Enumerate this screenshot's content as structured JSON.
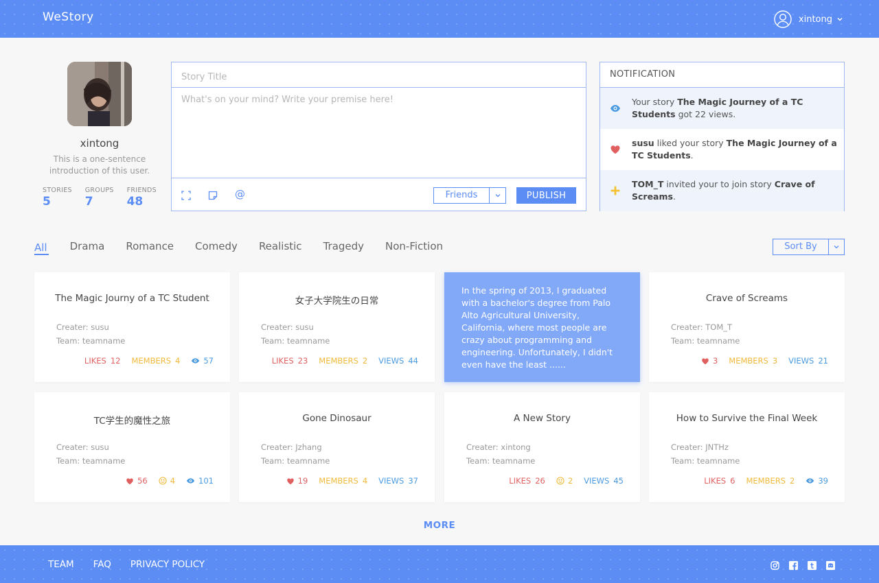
{
  "header": {
    "brand": "WeStory",
    "username": "xintong"
  },
  "profile": {
    "name": "xintong",
    "intro": "This is a one-sentence introduction of this user.",
    "stats": [
      {
        "label": "STORIES",
        "value": "5"
      },
      {
        "label": "GROUPS",
        "value": "7"
      },
      {
        "label": "FRIENDS",
        "value": "48"
      }
    ]
  },
  "composer": {
    "title_placeholder": "Story Title",
    "body_placeholder": "What's on your mind? Write your premise here!",
    "visibility": "Friends",
    "publish_label": "PUBLISH",
    "at_symbol": "@"
  },
  "notifications": {
    "heading": "NOTIFICATION",
    "items": [
      {
        "icon": "eye-icon",
        "p1": "Your story ",
        "b1": "The Magic Journey of a TC Students",
        "p2": " got 22 views.",
        "b2": "",
        "p3": ""
      },
      {
        "icon": "heart-icon",
        "p1": "",
        "b1": "susu",
        "p2": " liked your story ",
        "b2": "The Magic Journey of a TC Students",
        "p3": "."
      },
      {
        "icon": "plus-icon",
        "p1": "",
        "b1": "TOM_T",
        "p2": " invited your to join story ",
        "b2": "Crave of Screams",
        "p3": "."
      }
    ]
  },
  "tabs": [
    "All",
    "Drama",
    "Romance",
    "Comedy",
    "Realistic",
    "Tragedy",
    "Non-Fiction"
  ],
  "sort_label": "Sort By",
  "cards": [
    {
      "title": "The Magic Journy of a TC Student",
      "creator": "Creater: susu",
      "team": "Team: teamname",
      "likes": {
        "icon": false,
        "label": "LIKES",
        "value": "12"
      },
      "members": {
        "icon": false,
        "label": "MEMBERS",
        "value": "4"
      },
      "views": {
        "icon": true,
        "label": "",
        "value": "57"
      }
    },
    {
      "title": "女子大学院生の日常",
      "creator": "Creater: susu",
      "team": "Team: teamname",
      "likes": {
        "icon": false,
        "label": "LIKES",
        "value": "23"
      },
      "members": {
        "icon": false,
        "label": "MEMBERS",
        "value": "2"
      },
      "views": {
        "icon": false,
        "label": "VIEWS",
        "value": "44"
      }
    },
    {
      "preview": "In the spring of 2013, I graduated with a bachelor's degree from Palo Alto Agricultural University, California, where most people are crazy about programming and engineering. Unfortunately, I didn't even have the least  ......"
    },
    {
      "title": "Crave of Screams",
      "creator": "Creater: TOM_T",
      "team": "Team: teamname",
      "likes": {
        "icon": true,
        "label": "",
        "value": "3"
      },
      "members": {
        "icon": false,
        "label": "MEMBERS",
        "value": "3"
      },
      "views": {
        "icon": false,
        "label": "VIEWS",
        "value": "21"
      }
    },
    {
      "title": "TC学生的魔性之旅",
      "creator": "Creater: susu",
      "team": "Team: teamname",
      "likes": {
        "icon": true,
        "label": "",
        "value": "56"
      },
      "members": {
        "icon": true,
        "label": "",
        "value": "4"
      },
      "views": {
        "icon": true,
        "label": "",
        "value": "101"
      }
    },
    {
      "title": "Gone Dinosaur",
      "creator": "Creater: Jzhang",
      "team": "Team: teamname",
      "likes": {
        "icon": true,
        "label": "",
        "value": "19"
      },
      "members": {
        "icon": false,
        "label": "MEMBERS",
        "value": "4"
      },
      "views": {
        "icon": false,
        "label": "VIEWS",
        "value": "37"
      }
    },
    {
      "title": "A New Story",
      "creator": "Creater: xintong",
      "team": "Team: teamname",
      "likes": {
        "icon": false,
        "label": "LIKES",
        "value": "26"
      },
      "members": {
        "icon": true,
        "label": "",
        "value": "2"
      },
      "views": {
        "icon": false,
        "label": "VIEWS",
        "value": "45"
      }
    },
    {
      "title": "How to Survive the Final Week",
      "creator": "Creater: JNTHz",
      "team": "Team: teamname",
      "likes": {
        "icon": false,
        "label": "LIKES",
        "value": "6"
      },
      "members": {
        "icon": false,
        "label": "MEMBERS",
        "value": "2"
      },
      "views": {
        "icon": true,
        "label": "",
        "value": "39"
      }
    }
  ],
  "more_label": "MORE",
  "footer": {
    "links": [
      "TEAM",
      "FAQ",
      "PRIVACY POLICY"
    ],
    "social": [
      "instagram-icon",
      "facebook-icon",
      "tumblr-icon",
      "discord-icon"
    ]
  },
  "colors": {
    "primary": "#5b8df5",
    "likes": "#e06060",
    "members": "#f0b93a",
    "views": "#4a9ae0",
    "hover_card": "#82a8f8"
  }
}
